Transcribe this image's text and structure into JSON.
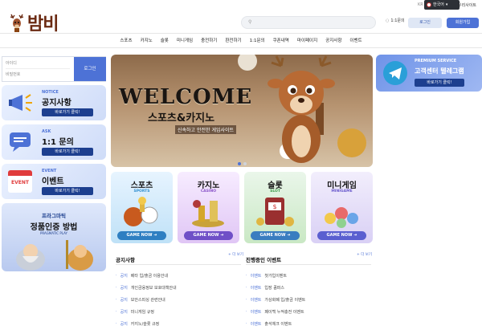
{
  "topbar": {
    "lang_top": "KR",
    "guide": "우리사이트"
  },
  "header": {
    "logo_text": "밤비",
    "search_placeholder": "",
    "message_label": "1:1문의",
    "login_button": "로그인",
    "join_button": "회원가입",
    "language": "한국어"
  },
  "nav": {
    "items": [
      "스포츠",
      "카지노",
      "슬롯",
      "미니게임",
      "충전하기",
      "환전하기",
      "1:1문의",
      "쿠폰내역",
      "마이페이지",
      "공지사항",
      "이벤트"
    ]
  },
  "login": {
    "id_placeholder": "아이디",
    "pw_placeholder": "비밀번호",
    "button": "로그인"
  },
  "left_cards": [
    {
      "kicker": "NOTICE",
      "title": "공지사항",
      "go": "바로가기 클릭!"
    },
    {
      "kicker": "ASK",
      "title": "1:1 문의",
      "go": "바로가기 클릭!"
    },
    {
      "kicker": "EVENT",
      "title": "이벤트",
      "go": "바로가기 클릭!",
      "icon_text": "EVENT"
    },
    {
      "kicker": "프라그마틱",
      "title": "정품인증 방법",
      "sub": "PRAGMATIC PLAY"
    }
  ],
  "banner": {
    "title": "WELCOME",
    "subtitle": "스포츠&카지노",
    "tagline": "신속하고 안전한 게임사이트"
  },
  "categories": [
    {
      "name": "스포츠",
      "eng": "SPORTS",
      "cta": "GAME NOW ➜"
    },
    {
      "name": "카지노",
      "eng": "CASINO",
      "cta": "GAME NOW ➜"
    },
    {
      "name": "슬롯",
      "eng": "SLOT",
      "cta": "GAME NOW ➜"
    },
    {
      "name": "미니게임",
      "eng": "MINIGAME",
      "cta": "GAME NOW ➜"
    }
  ],
  "notice": {
    "title": "공지사항",
    "more": "+ 더 보기",
    "rows": [
      {
        "tag": "공지",
        "text": "베타 입/출금 이용안내"
      },
      {
        "tag": "공지",
        "text": "개인금융정보 보호대책안내"
      },
      {
        "tag": "공지",
        "text": "보안스피싱 관련안내"
      },
      {
        "tag": "공지",
        "text": "미니게임 규정"
      },
      {
        "tag": "공지",
        "text": "카지노/슬롯 규정"
      }
    ]
  },
  "events": {
    "title": "진행중인 이벤트",
    "more": "+ 더 보기",
    "rows": [
      {
        "tag": "이벤트",
        "text": "첫가입이벤트"
      },
      {
        "tag": "이벤트",
        "text": "입장 콤퍼스"
      },
      {
        "tag": "이벤트",
        "text": "가상화폐 입/출금 이벤트"
      },
      {
        "tag": "이벤트",
        "text": "페이백 누적충전 이벤트"
      },
      {
        "tag": "이벤트",
        "text": "출석체크 이벤트"
      }
    ]
  },
  "telegram": {
    "kicker": "PREMIUM SERVICE",
    "title": "고객센터 텔레그램",
    "go": "바로가기 클릭!"
  },
  "colors": {
    "accent": "#4d72d6",
    "dark_blue": "#1d3f8f",
    "brand_brown": "#6b2a12"
  }
}
